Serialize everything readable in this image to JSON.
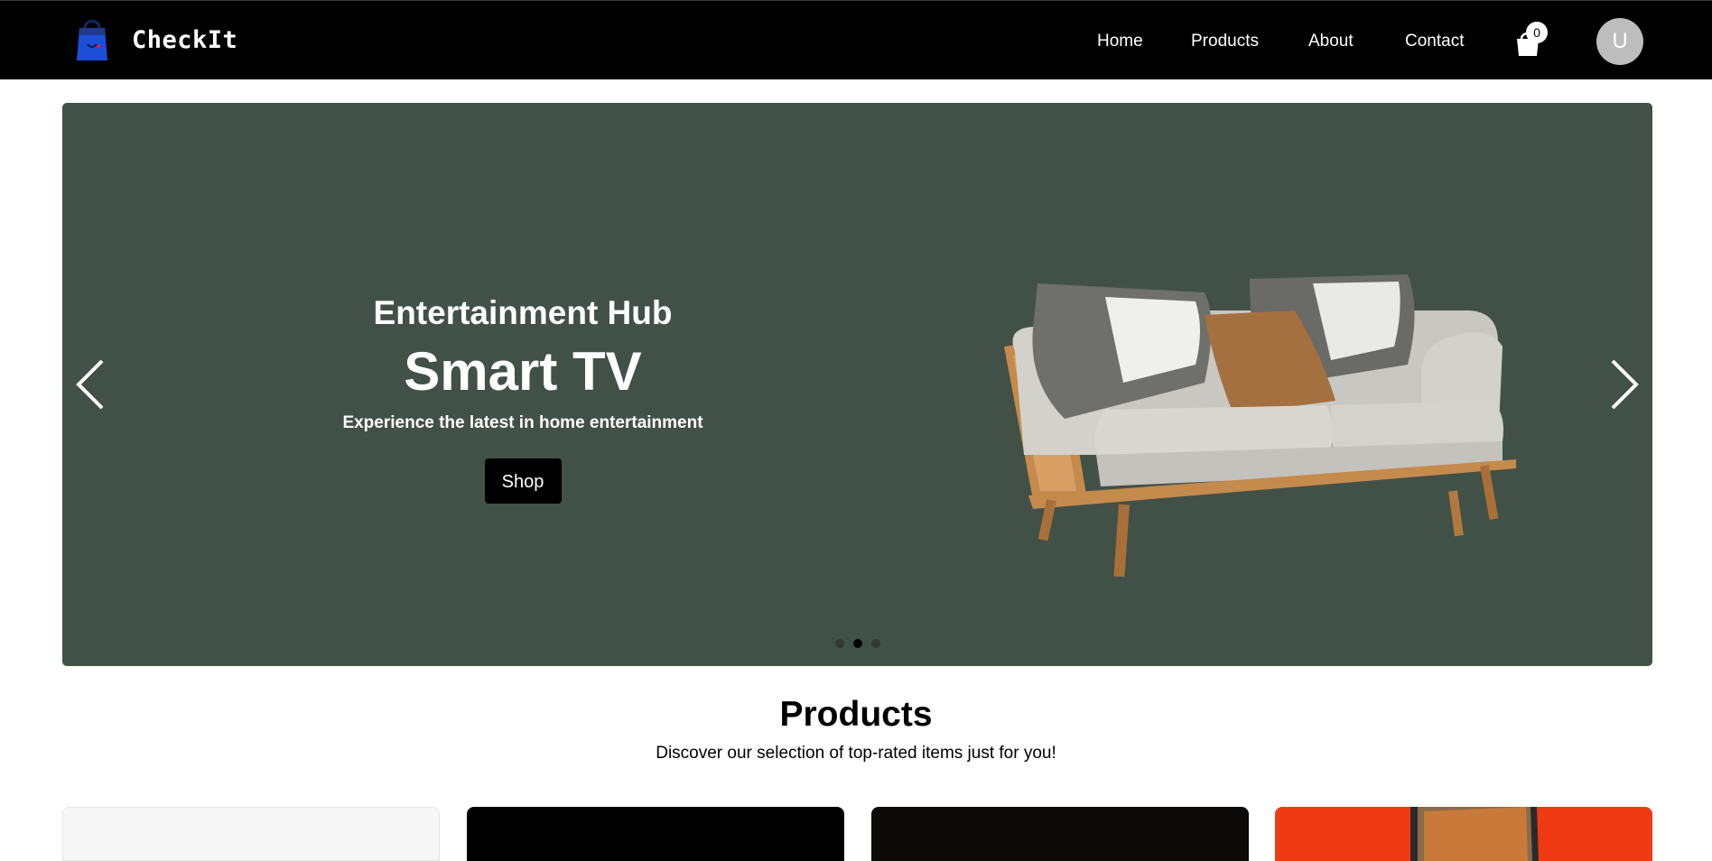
{
  "brand": {
    "name": "CheckIt",
    "logo_icon": "shopping-bag-icon"
  },
  "nav": {
    "links": [
      "Home",
      "Products",
      "About",
      "Contact"
    ],
    "cart_count": "0",
    "avatar_initial": "U"
  },
  "hero": {
    "eyebrow": "Entertainment Hub",
    "title": "Smart TV",
    "subtitle": "Experience the latest in home entertainment",
    "button_label": "Shop",
    "image": "sofa-image",
    "prev_icon": "chevron-left-icon",
    "next_icon": "chevron-right-icon",
    "slide_count": 3,
    "active_slide": 2
  },
  "products": {
    "heading": "Products",
    "subheading": "Discover our selection of top-rated items just for you!"
  },
  "colors": {
    "navbar_bg": "#000000",
    "hero_bg": "#425147",
    "button_bg": "#000000",
    "accent_card": "#f03a14"
  }
}
